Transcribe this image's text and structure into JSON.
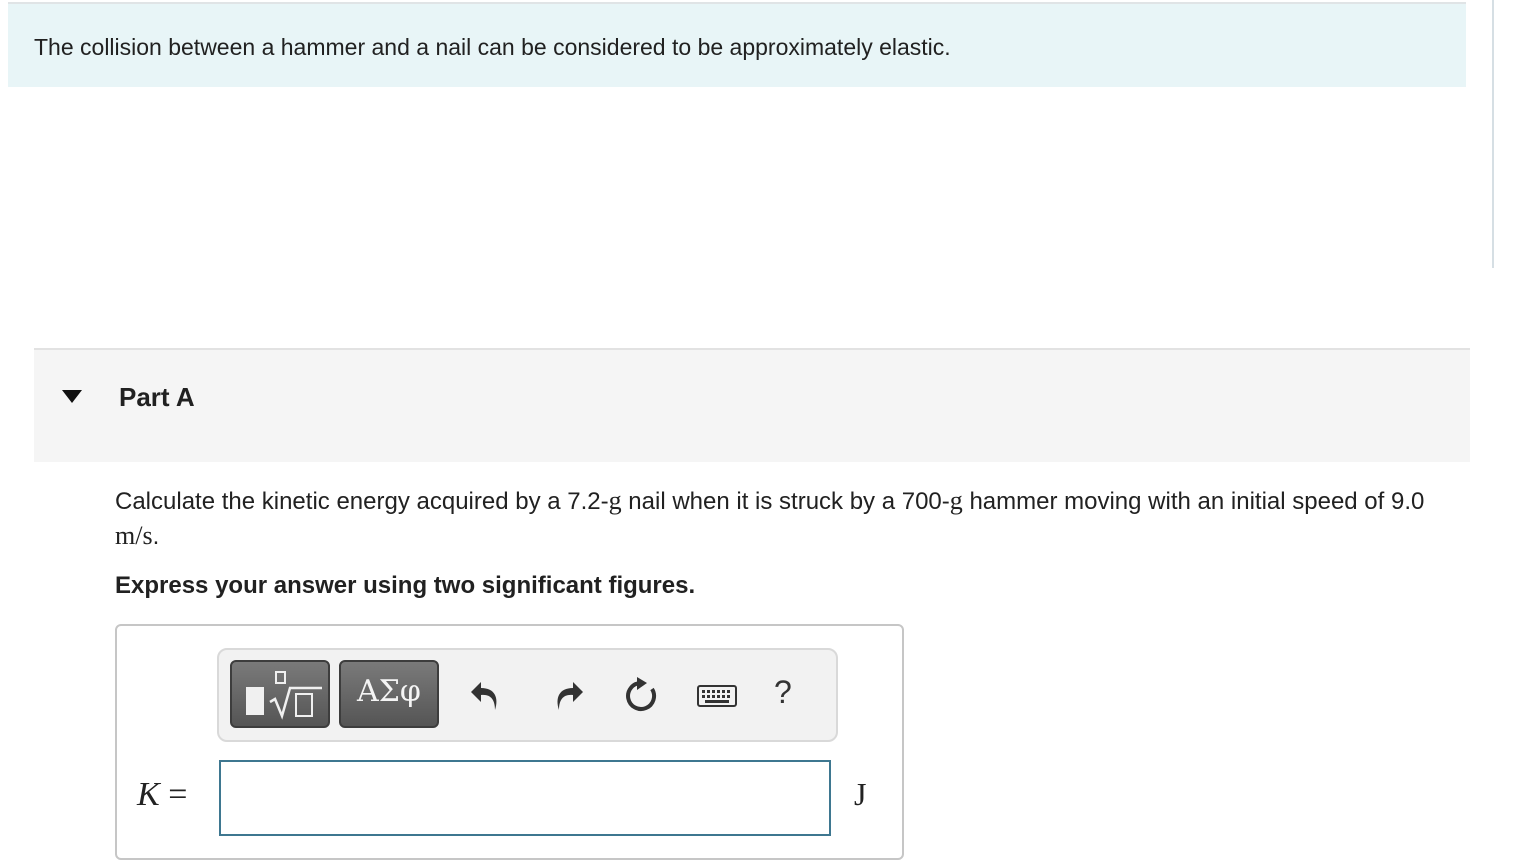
{
  "intro": {
    "text": "The collision between a hammer and a nail can be considered to be approximately elastic."
  },
  "part": {
    "title": "Part A",
    "toggle_icon": "caret-down-icon"
  },
  "question": {
    "text_1": "Calculate the kinetic energy acquired by a 7.2-",
    "unit_g_1": "g",
    "text_2": " nail when it is struck by a 700-",
    "unit_g_2": "g",
    "text_3": " hammer moving with an initial speed of 9.0 ",
    "speed_unit": "m/s",
    "text_4": "."
  },
  "instruction": "Express your answer using two significant figures.",
  "toolbar": {
    "templates_icon": "templates-radical-icon",
    "symbols_label": "ΑΣφ",
    "undo_icon": "undo-icon",
    "redo_icon": "redo-icon",
    "reset_icon": "reset-icon",
    "keyboard_icon": "keyboard-icon",
    "help_label": "?"
  },
  "answer": {
    "variable": "K",
    "equals": "=",
    "value": "",
    "unit": "J"
  }
}
